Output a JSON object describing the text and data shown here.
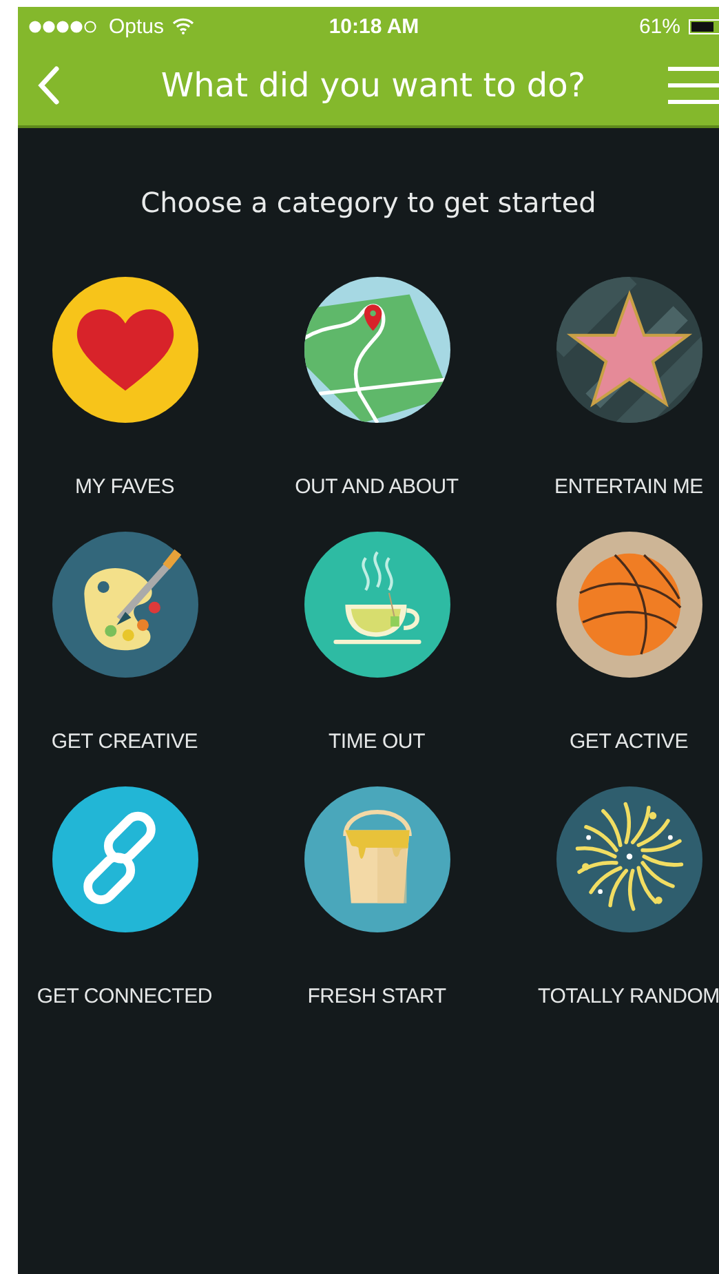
{
  "status_bar": {
    "carrier": "Optus",
    "time": "10:18 AM",
    "battery": "61%"
  },
  "nav_bar": {
    "title": "What did you want to do?"
  },
  "prompt": "Choose a category to get started",
  "categories": [
    {
      "label": "MY FAVES",
      "kind": "heart"
    },
    {
      "label": "OUT AND ABOUT",
      "kind": "map"
    },
    {
      "label": "ENTERTAIN ME",
      "kind": "star"
    },
    {
      "label": "GET CREATIVE",
      "kind": "palette"
    },
    {
      "label": "TIME OUT",
      "kind": "tea"
    },
    {
      "label": "GET ACTIVE",
      "kind": "ball"
    },
    {
      "label": "GET CONNECTED",
      "kind": "link"
    },
    {
      "label": "FRESH START",
      "kind": "bucket"
    },
    {
      "label": "TOTALLY RANDOM",
      "kind": "fireworks"
    }
  ]
}
